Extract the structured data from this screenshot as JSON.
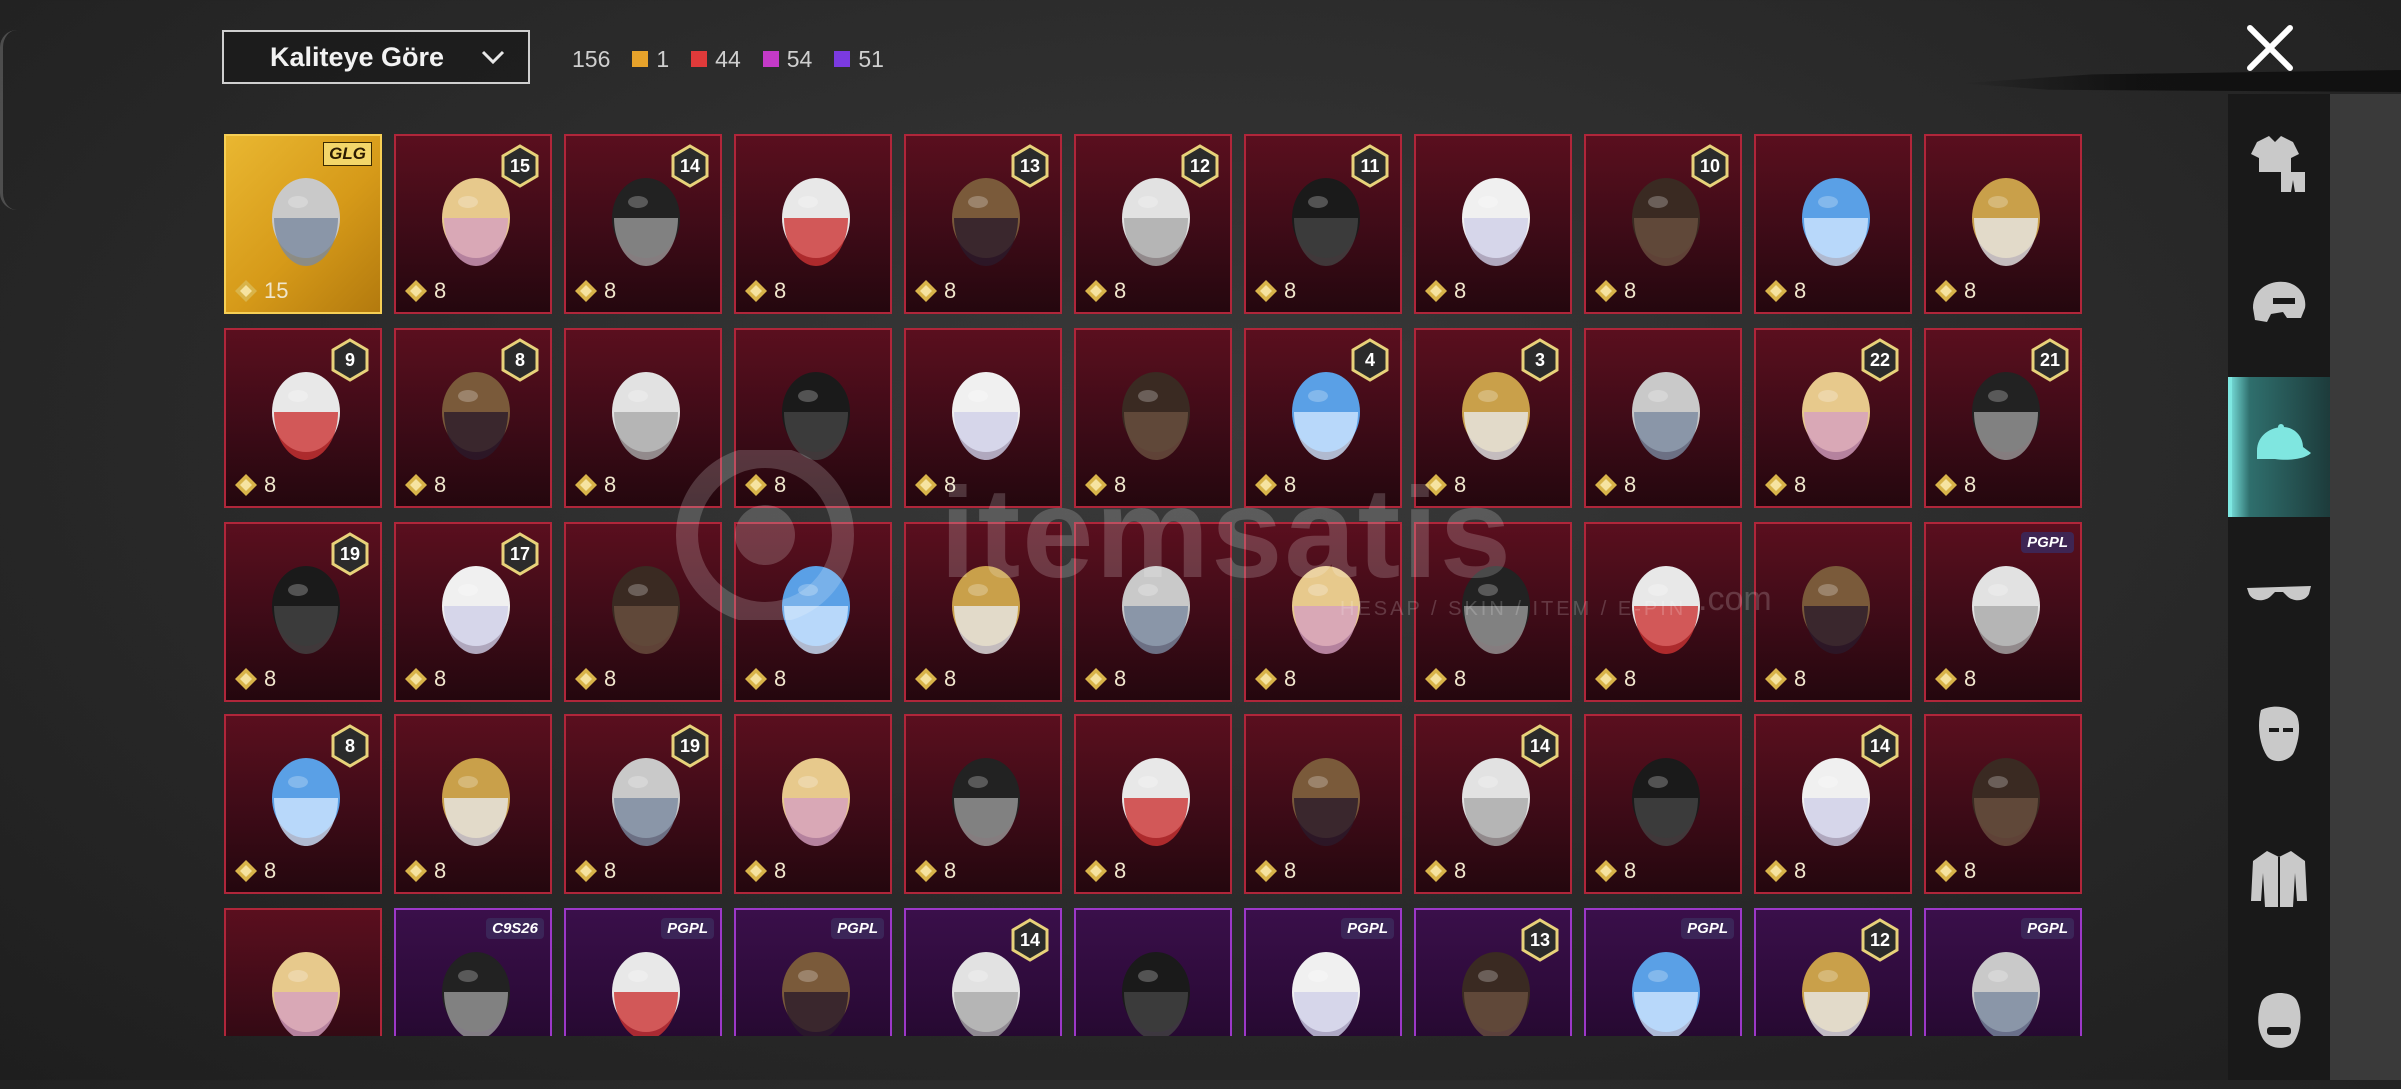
{
  "header": {
    "sort_label": "Kaliteye Göre",
    "total_count": "156",
    "quality_counts": [
      {
        "value": "1",
        "color": "#e6a22b"
      },
      {
        "value": "44",
        "color": "#e03a3a"
      },
      {
        "value": "54",
        "color": "#c43ac8"
      },
      {
        "value": "51",
        "color": "#7b3ae0"
      }
    ]
  },
  "watermark": {
    "brand": "itemsatis",
    "sub": "HESAP / SKIN / ITEM / E-PIN",
    "com": ".com"
  },
  "grid": {
    "rows": [
      [
        {
          "cost": "15",
          "badge": "",
          "tag": "GLG",
          "rarity": "gold"
        },
        {
          "cost": "8",
          "badge": "15",
          "tag": "",
          "rarity": "red"
        },
        {
          "cost": "8",
          "badge": "14",
          "tag": "",
          "rarity": "red"
        },
        {
          "cost": "8",
          "badge": "",
          "tag": "",
          "rarity": "red"
        },
        {
          "cost": "8",
          "badge": "13",
          "tag": "",
          "rarity": "red"
        },
        {
          "cost": "8",
          "badge": "12",
          "tag": "",
          "rarity": "red"
        },
        {
          "cost": "8",
          "badge": "11",
          "tag": "",
          "rarity": "red"
        },
        {
          "cost": "8",
          "badge": "",
          "tag": "",
          "rarity": "red"
        },
        {
          "cost": "8",
          "badge": "10",
          "tag": "",
          "rarity": "red"
        },
        {
          "cost": "8",
          "badge": "",
          "tag": "",
          "rarity": "red"
        },
        {
          "cost": "8",
          "badge": "",
          "tag": "",
          "rarity": "red"
        }
      ],
      [
        {
          "cost": "8",
          "badge": "9",
          "tag": "",
          "rarity": "red"
        },
        {
          "cost": "8",
          "badge": "8",
          "tag": "",
          "rarity": "red"
        },
        {
          "cost": "8",
          "badge": "",
          "tag": "",
          "rarity": "red"
        },
        {
          "cost": "8",
          "badge": "",
          "tag": "",
          "rarity": "red"
        },
        {
          "cost": "8",
          "badge": "",
          "tag": "",
          "rarity": "red"
        },
        {
          "cost": "8",
          "badge": "",
          "tag": "",
          "rarity": "red"
        },
        {
          "cost": "8",
          "badge": "4",
          "tag": "",
          "rarity": "red"
        },
        {
          "cost": "8",
          "badge": "3",
          "tag": "",
          "rarity": "red"
        },
        {
          "cost": "8",
          "badge": "",
          "tag": "",
          "rarity": "red"
        },
        {
          "cost": "8",
          "badge": "22",
          "tag": "",
          "rarity": "red"
        },
        {
          "cost": "8",
          "badge": "21",
          "tag": "",
          "rarity": "red"
        }
      ],
      [
        {
          "cost": "8",
          "badge": "19",
          "tag": "",
          "rarity": "red"
        },
        {
          "cost": "8",
          "badge": "17",
          "tag": "",
          "rarity": "red"
        },
        {
          "cost": "8",
          "badge": "",
          "tag": "",
          "rarity": "red"
        },
        {
          "cost": "8",
          "badge": "",
          "tag": "",
          "rarity": "red"
        },
        {
          "cost": "8",
          "badge": "",
          "tag": "",
          "rarity": "red"
        },
        {
          "cost": "8",
          "badge": "",
          "tag": "",
          "rarity": "red"
        },
        {
          "cost": "8",
          "badge": "",
          "tag": "",
          "rarity": "red"
        },
        {
          "cost": "8",
          "badge": "",
          "tag": "",
          "rarity": "red"
        },
        {
          "cost": "8",
          "badge": "",
          "tag": "",
          "rarity": "red"
        },
        {
          "cost": "8",
          "badge": "",
          "tag": "",
          "rarity": "red"
        },
        {
          "cost": "8",
          "badge": "",
          "tag": "PGPL",
          "rarity": "red"
        }
      ],
      [
        {
          "cost": "8",
          "badge": "8",
          "tag": "",
          "rarity": "red"
        },
        {
          "cost": "8",
          "badge": "",
          "tag": "",
          "rarity": "red"
        },
        {
          "cost": "8",
          "badge": "19",
          "tag": "",
          "rarity": "red"
        },
        {
          "cost": "8",
          "badge": "",
          "tag": "",
          "rarity": "red"
        },
        {
          "cost": "8",
          "badge": "",
          "tag": "",
          "rarity": "red"
        },
        {
          "cost": "8",
          "badge": "",
          "tag": "",
          "rarity": "red"
        },
        {
          "cost": "8",
          "badge": "",
          "tag": "",
          "rarity": "red"
        },
        {
          "cost": "8",
          "badge": "14",
          "tag": "",
          "rarity": "red"
        },
        {
          "cost": "8",
          "badge": "",
          "tag": "",
          "rarity": "red"
        },
        {
          "cost": "8",
          "badge": "14",
          "tag": "",
          "rarity": "red"
        },
        {
          "cost": "8",
          "badge": "",
          "tag": "",
          "rarity": "red"
        }
      ],
      [
        {
          "cost": "",
          "badge": "",
          "tag": "",
          "rarity": "red"
        },
        {
          "cost": "",
          "badge": "",
          "tag": "C9S26",
          "rarity": "purple"
        },
        {
          "cost": "",
          "badge": "",
          "tag": "PGPL",
          "rarity": "purple"
        },
        {
          "cost": "",
          "badge": "",
          "tag": "PGPL",
          "rarity": "purple"
        },
        {
          "cost": "",
          "badge": "14",
          "tag": "",
          "rarity": "purple"
        },
        {
          "cost": "",
          "badge": "",
          "tag": "",
          "rarity": "purple"
        },
        {
          "cost": "",
          "badge": "",
          "tag": "PGPL",
          "rarity": "purple"
        },
        {
          "cost": "",
          "badge": "13",
          "tag": "",
          "rarity": "purple"
        },
        {
          "cost": "",
          "badge": "",
          "tag": "PGPL",
          "rarity": "purple"
        },
        {
          "cost": "",
          "badge": "12",
          "tag": "",
          "rarity": "purple"
        },
        {
          "cost": "",
          "badge": "",
          "tag": "PGPL",
          "rarity": "purple"
        }
      ]
    ]
  },
  "sidebar": {
    "categories": [
      {
        "name": "outfits",
        "icon": "outfit-icon",
        "active": false
      },
      {
        "name": "helmets",
        "icon": "helmet-icon",
        "active": false
      },
      {
        "name": "hats",
        "icon": "cap-icon",
        "active": true
      },
      {
        "name": "glasses",
        "icon": "glasses-icon",
        "active": false
      },
      {
        "name": "masks",
        "icon": "mask-icon",
        "active": false
      },
      {
        "name": "tops",
        "icon": "jacket-icon",
        "active": false
      },
      {
        "name": "faces",
        "icon": "face-icon",
        "active": false
      }
    ]
  }
}
